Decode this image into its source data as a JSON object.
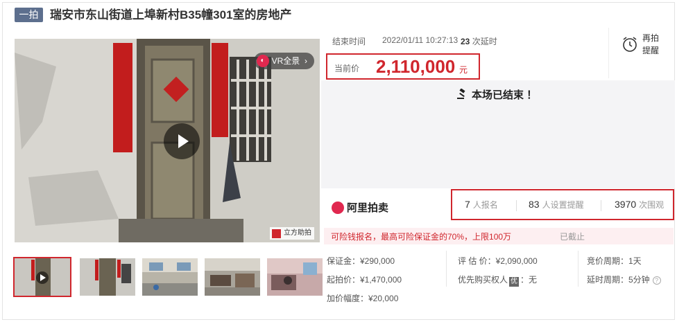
{
  "header": {
    "badge": "一拍",
    "title": "瑞安市东山街道上埠新村B35幢301室的房地产"
  },
  "gallery": {
    "vr_label": "VR全景",
    "watermark": "立方助拍",
    "thumbnail_count": 5
  },
  "auction": {
    "end_label": "结束时间",
    "end_time": "2022/01/11 10:27:13",
    "delay_count": "23",
    "delay_label": "次延时",
    "remind_label": "再拍提醒",
    "price_label": "当前价",
    "price_value": "2,110,000",
    "price_unit": "元",
    "status_text": "本场已结束 ！"
  },
  "platform": {
    "name": "阿里拍卖"
  },
  "stats": [
    {
      "value": "7",
      "unit": "人报名"
    },
    {
      "value": "83",
      "unit": "人设置提醒"
    },
    {
      "value": "3970",
      "unit": "次围观"
    }
  ],
  "notice": {
    "text": "可险钱报名，最高可险保证金的70%，上限100万",
    "status": "已截止"
  },
  "details": {
    "deposit": "保证金：¥290,000",
    "start_price": "起拍价：¥1,470,000",
    "increment": "加价幅度：¥20,000",
    "appraisal": "评 估 价：¥2,090,000",
    "priority_label": "优先购买权人",
    "priority_tag": "优",
    "priority_value": "：无",
    "bid_cycle": "竞价周期：1天",
    "delay_cycle": "延时周期：5分钟"
  },
  "colors": {
    "accent": "#d0262d",
    "badge": "#5d6f8e",
    "brand": "#e0284f"
  }
}
